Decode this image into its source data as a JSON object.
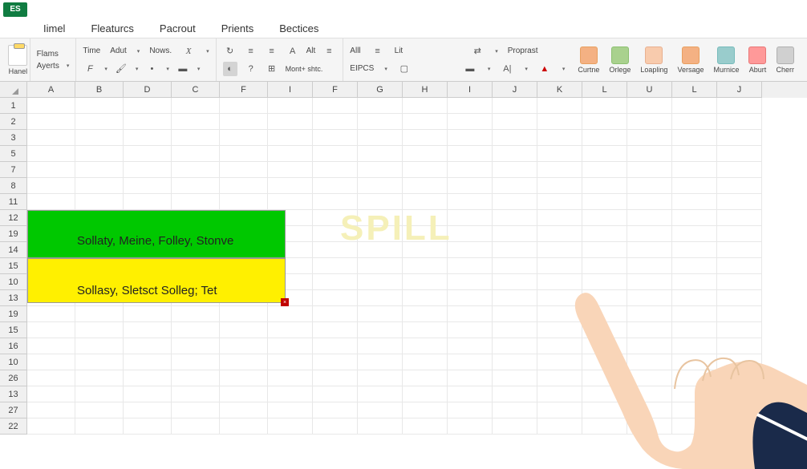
{
  "app": {
    "badge": "ES"
  },
  "menu": {
    "items": [
      "Iimel",
      "Fleaturcs",
      "Pacrout",
      "Prients",
      "Bectices"
    ]
  },
  "ribbon": {
    "paste_label": "Hanel",
    "section1": {
      "row1": [
        "Flams"
      ],
      "row2": [
        "Ayerts"
      ]
    },
    "section2": {
      "row1a": "Time",
      "row1b": "Adut",
      "row1c": "Nows."
    },
    "section3": {
      "text": "Mont+ shtc."
    },
    "section4": {
      "row1a": "Alll",
      "row1b": "Lit",
      "row1c": "Proprast",
      "row2": "EIPCS"
    },
    "section5": {
      "alt": "Alt"
    },
    "tools": [
      {
        "label": "Curtne",
        "color": "orange"
      },
      {
        "label": "Orlege",
        "color": "green"
      },
      {
        "label": "Loapling",
        "color": "pink"
      },
      {
        "label": "Versage",
        "color": "orange"
      },
      {
        "label": "Murnice",
        "color": "teal"
      },
      {
        "label": "Aburt",
        "color": "red"
      },
      {
        "label": "Cherr",
        "color": "gray"
      }
    ]
  },
  "grid": {
    "columns": [
      {
        "label": "A",
        "width": 60
      },
      {
        "label": "B",
        "width": 60
      },
      {
        "label": "D",
        "width": 60
      },
      {
        "label": "C",
        "width": 60
      },
      {
        "label": "F",
        "width": 60
      },
      {
        "label": "I",
        "width": 56
      },
      {
        "label": "F",
        "width": 56
      },
      {
        "label": "G",
        "width": 56
      },
      {
        "label": "H",
        "width": 56
      },
      {
        "label": "I",
        "width": 56
      },
      {
        "label": "J",
        "width": 56
      },
      {
        "label": "K",
        "width": 56
      },
      {
        "label": "L",
        "width": 56
      },
      {
        "label": "U",
        "width": 56
      },
      {
        "label": "L",
        "width": 56
      },
      {
        "label": "J",
        "width": 56
      }
    ],
    "rows": [
      "1",
      "2",
      "3",
      "5",
      "7",
      "8",
      "11",
      "12",
      "19",
      "14",
      "15",
      "10",
      "13",
      "19",
      "15",
      "16",
      "10",
      "26",
      "13",
      "27",
      "22"
    ]
  },
  "blocks": {
    "green_text": "Sollaty, Meine,  Folley,  Stonve",
    "yellow_text": "Sollasy, Sletsct  Solleg;  Tet",
    "error": "×"
  },
  "overlay": {
    "spill": "SPILL"
  }
}
